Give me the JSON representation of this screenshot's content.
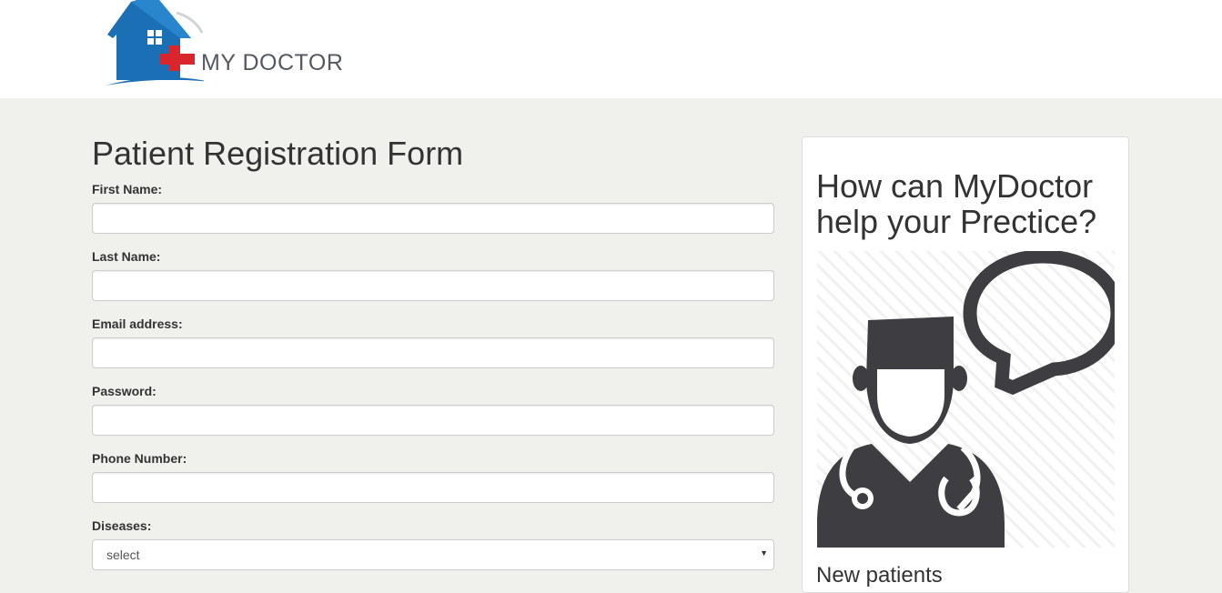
{
  "header": {
    "logo_text": "MY DOCTOR"
  },
  "form": {
    "title": "Patient Registration Form",
    "fields": [
      {
        "label": "First Name:",
        "value": ""
      },
      {
        "label": "Last Name:",
        "value": ""
      },
      {
        "label": "Email address:",
        "value": ""
      },
      {
        "label": "Password:",
        "value": ""
      },
      {
        "label": "Phone Number:",
        "value": ""
      }
    ],
    "diseases": {
      "label": "Diseases:",
      "selected": "select"
    }
  },
  "sidebar": {
    "title": "How can MyDoctor help your Prectice?",
    "subtitle": "New patients"
  },
  "colors": {
    "page_bg": "#f0f0ec",
    "logo_blue": "#1a6fb5",
    "logo_red": "#d9262c",
    "icon_dark": "#3d3d42"
  }
}
